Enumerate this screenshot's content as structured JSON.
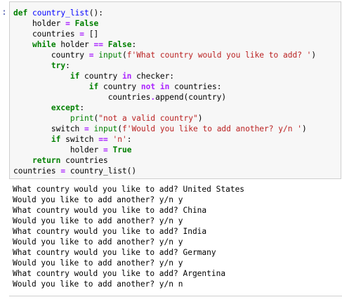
{
  "cell": {
    "prompt_marker": ":",
    "code_lines": [
      [
        {
          "t": "def",
          "c": "kw"
        },
        {
          "t": " "
        },
        {
          "t": "country_list",
          "c": "fn"
        },
        {
          "t": "():"
        }
      ],
      [
        {
          "t": "    holder "
        },
        {
          "t": "=",
          "c": "op"
        },
        {
          "t": " "
        },
        {
          "t": "False",
          "c": "kw"
        }
      ],
      [
        {
          "t": "    countries "
        },
        {
          "t": "=",
          "c": "op"
        },
        {
          "t": " []"
        }
      ],
      [
        {
          "t": "    "
        },
        {
          "t": "while",
          "c": "kw"
        },
        {
          "t": " holder "
        },
        {
          "t": "==",
          "c": "op"
        },
        {
          "t": " "
        },
        {
          "t": "False",
          "c": "kw"
        },
        {
          "t": ":"
        }
      ],
      [
        {
          "t": "        country "
        },
        {
          "t": "=",
          "c": "op"
        },
        {
          "t": " "
        },
        {
          "t": "input",
          "c": "bi"
        },
        {
          "t": "("
        },
        {
          "t": "f'What country would you like to add? '",
          "c": "str"
        },
        {
          "t": ")"
        }
      ],
      [
        {
          "t": "        "
        },
        {
          "t": "try",
          "c": "kw"
        },
        {
          "t": ":"
        }
      ],
      [
        {
          "t": "            "
        },
        {
          "t": "if",
          "c": "kw"
        },
        {
          "t": " country "
        },
        {
          "t": "in",
          "c": "op"
        },
        {
          "t": " checker:"
        }
      ],
      [
        {
          "t": "                "
        },
        {
          "t": "if",
          "c": "kw"
        },
        {
          "t": " country "
        },
        {
          "t": "not",
          "c": "op"
        },
        {
          "t": " "
        },
        {
          "t": "in",
          "c": "op"
        },
        {
          "t": " countries:"
        }
      ],
      [
        {
          "t": "                    countries"
        },
        {
          "t": ".",
          "c": "op"
        },
        {
          "t": "append(country)"
        }
      ],
      [
        {
          "t": "        "
        },
        {
          "t": "except",
          "c": "kw"
        },
        {
          "t": ":"
        }
      ],
      [
        {
          "t": "            "
        },
        {
          "t": "print",
          "c": "bi"
        },
        {
          "t": "("
        },
        {
          "t": "\"not a valid country\"",
          "c": "str"
        },
        {
          "t": ")"
        }
      ],
      [
        {
          "t": "        switch "
        },
        {
          "t": "=",
          "c": "op"
        },
        {
          "t": " "
        },
        {
          "t": "input",
          "c": "bi"
        },
        {
          "t": "("
        },
        {
          "t": "f'Would you like to add another? y/n '",
          "c": "str"
        },
        {
          "t": ")"
        }
      ],
      [
        {
          "t": "        "
        },
        {
          "t": "if",
          "c": "kw"
        },
        {
          "t": " switch "
        },
        {
          "t": "==",
          "c": "op"
        },
        {
          "t": " "
        },
        {
          "t": "'n'",
          "c": "str"
        },
        {
          "t": ":"
        }
      ],
      [
        {
          "t": "            holder "
        },
        {
          "t": "=",
          "c": "op"
        },
        {
          "t": " "
        },
        {
          "t": "True",
          "c": "kw"
        }
      ],
      [
        {
          "t": "    "
        },
        {
          "t": "return",
          "c": "kw"
        },
        {
          "t": " countries"
        }
      ],
      [
        {
          "t": "countries "
        },
        {
          "t": "=",
          "c": "op"
        },
        {
          "t": " country_list()"
        }
      ]
    ]
  },
  "output": {
    "lines": [
      "What country would you like to add? United States",
      "Would you like to add another? y/n y",
      "What country would you like to add? China",
      "Would you like to add another? y/n y",
      "What country would you like to add? India",
      "Would you like to add another? y/n y",
      "What country would you like to add? Germany",
      "Would you like to add another? y/n y",
      "What country would you like to add? Argentina",
      "Would you like to add another? y/n n"
    ]
  }
}
